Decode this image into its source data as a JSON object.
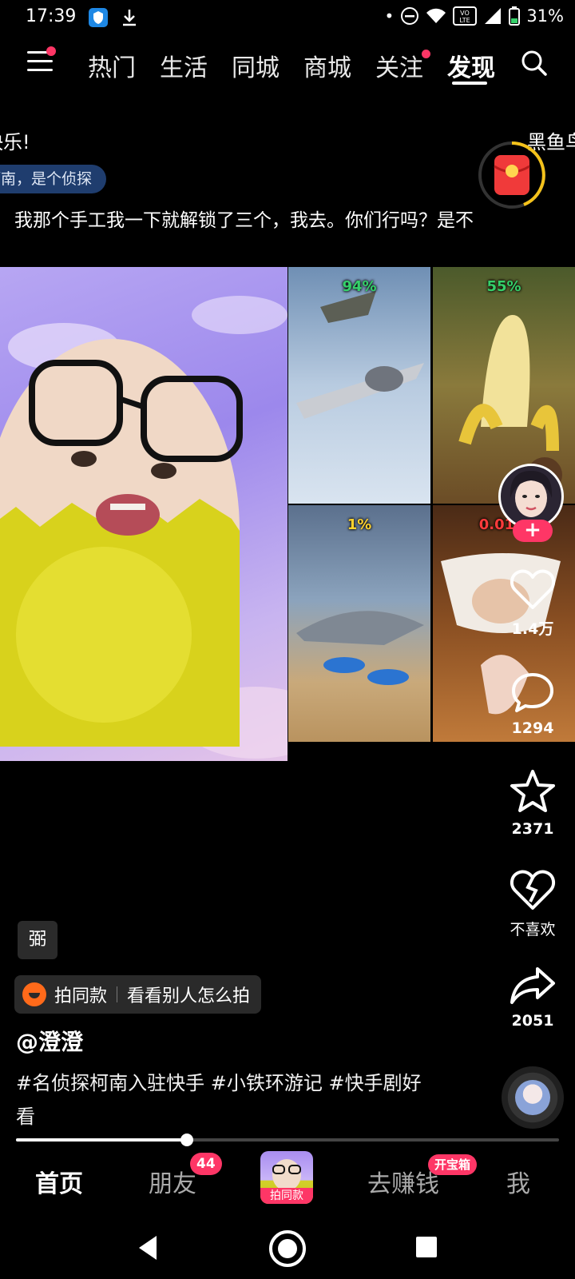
{
  "status_bar": {
    "time": "17:39",
    "battery": "31%",
    "icons": [
      "shield-app-icon",
      "download-icon",
      "dot-icon",
      "do-not-disturb-icon",
      "wifi-icon",
      "volte-icon",
      "signal-icon",
      "battery-icon"
    ]
  },
  "top_nav": {
    "tabs": [
      "热门",
      "生活",
      "同城",
      "商城",
      "关注",
      "发现"
    ],
    "active_tab": "发现"
  },
  "overlay": {
    "danmu_left": "快乐!",
    "danmu_right": "黑鱼鸟",
    "danmu_pill": "柯南，是个侦探",
    "subtitle": "我那个手工我一下就解锁了三个，我去。你们行吗？是不"
  },
  "video": {
    "grid_percent": [
      "94%",
      "55%",
      "1%",
      "0.01%"
    ]
  },
  "rail": {
    "like_count": "1.4万",
    "comment_count": "1294",
    "favorite_count": "2371",
    "dislike_label": "不喜欢",
    "share_count": "2051",
    "follow_symbol": "+"
  },
  "info": {
    "tag_chip": "弼",
    "same_style_label": "拍同款",
    "same_style_link": "看看别人怎么拍",
    "author": "@澄澄",
    "caption": "#名侦探柯南入驻快手 #小铁环游记 #快手剧好看"
  },
  "progress": {
    "fraction": 0.315
  },
  "bottom_nav": {
    "home": "首页",
    "friends": "朋友",
    "friends_badge": "44",
    "center_label": "拍同款",
    "earn": "去赚钱",
    "earn_badge": "开宝箱",
    "me": "我"
  },
  "colors": {
    "accent": "#fe3666",
    "percent_green": "#35d06a",
    "background": "#000000"
  }
}
